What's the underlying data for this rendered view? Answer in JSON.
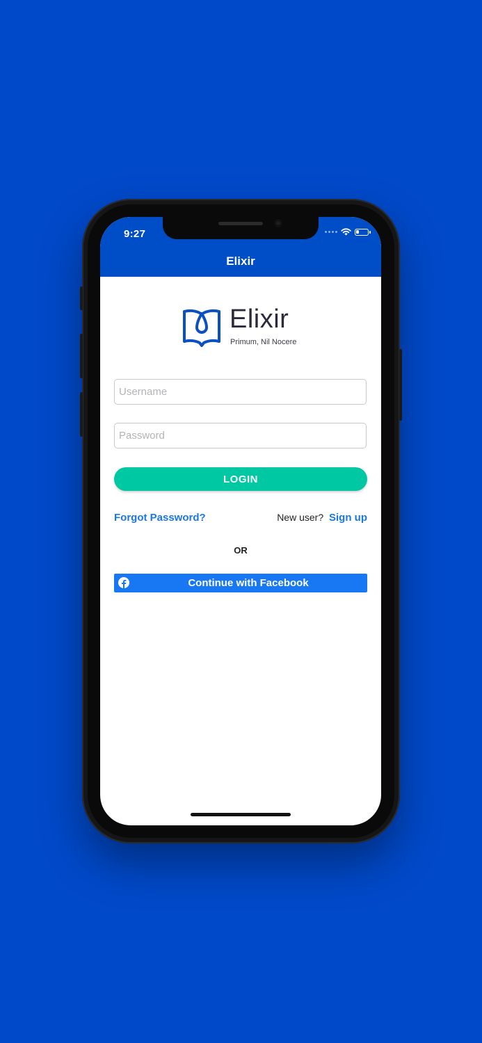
{
  "status_bar": {
    "time": "9:27"
  },
  "nav": {
    "title": "Elixir"
  },
  "logo": {
    "wordmark": "Elixir",
    "tagline": "Primum, Nil Nocere"
  },
  "form": {
    "username_placeholder": "Username",
    "password_placeholder": "Password",
    "login_label": "LOGIN"
  },
  "links": {
    "forgot_password": "Forgot Password?",
    "new_user": "New user?",
    "sign_up": "Sign up"
  },
  "divider": {
    "or": "OR"
  },
  "facebook": {
    "label": "Continue with Facebook",
    "icon": "facebook-icon"
  },
  "colors": {
    "brand_blue": "#004dc8",
    "accent_teal": "#00c8a3",
    "link_blue": "#1a78e6",
    "facebook_blue": "#1877f2"
  }
}
